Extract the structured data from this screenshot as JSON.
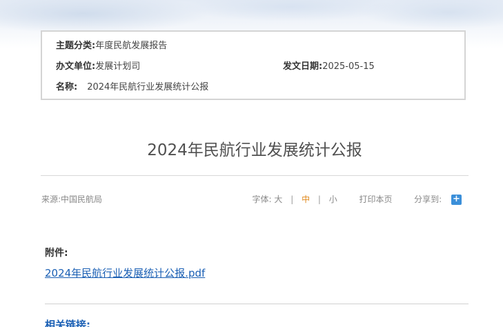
{
  "info": {
    "topic_label": "主题分类:",
    "topic_value": "年度民航发展报告",
    "office_label": "办文单位:",
    "office_value": "发展计划司",
    "date_label": "发文日期:",
    "date_value": "2025-05-15",
    "name_label": "名称:",
    "name_value": "2024年民航行业发展统计公报"
  },
  "article": {
    "title": "2024年民航行业发展统计公报"
  },
  "meta": {
    "source": "来源:中国民航局",
    "font_label": "字体:",
    "font_large": "大",
    "font_medium": "中",
    "font_small": "小",
    "separator": "|",
    "print": "打印本页",
    "share": "分享到:",
    "share_icon_glyph": "+"
  },
  "attachments": {
    "label": "附件:",
    "file": "2024年民航行业发展统计公报.pdf"
  },
  "related": {
    "label": "相关链接:"
  },
  "colors": {
    "active_font": "#e08a1e",
    "link": "#1a5fb4",
    "share_icon": "#3b8fd9"
  }
}
